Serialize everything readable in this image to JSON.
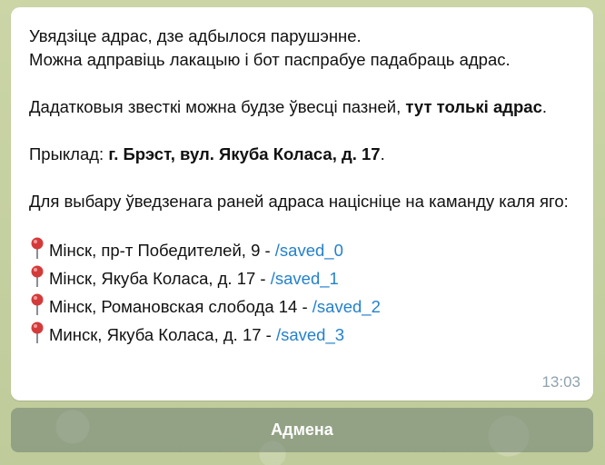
{
  "message": {
    "line1": "Увядзіце адрас, дзе адбылося парушэнне.",
    "line2": "Можна адправіць лакацыю і бот паспрабуе падабраць адрас.",
    "extra_prefix": "Дадатковыя звесткі можна будзе ўвесці пазней, ",
    "extra_bold": "тут толькі адрас",
    "extra_suffix": ".",
    "example_prefix": "Прыклад:  ",
    "example_bold": "г. Брэст, вул. Якуба Коласа, д. 17",
    "example_suffix": ".",
    "choose_text": "Для выбару ўведзенага раней адраса націсніце на каманду каля яго:",
    "saved": [
      {
        "address": "Мінск, пр-т Победителей, 9 - ",
        "command": "/saved_0"
      },
      {
        "address": "Мінск, Якуба Коласа, д. 17 - ",
        "command": "/saved_1"
      },
      {
        "address": "Мінск, Романовская слобода 14 - ",
        "command": "/saved_2"
      },
      {
        "address": "Минск, Якуба Коласа, д. 17 - ",
        "command": "/saved_3"
      }
    ],
    "time": "13:03"
  },
  "keyboard": {
    "cancel_label": "Адмена"
  },
  "colors": {
    "link": "#2481cc",
    "pin": "#d33b3b"
  },
  "icons": {
    "pin": "round-pushpin-icon"
  }
}
